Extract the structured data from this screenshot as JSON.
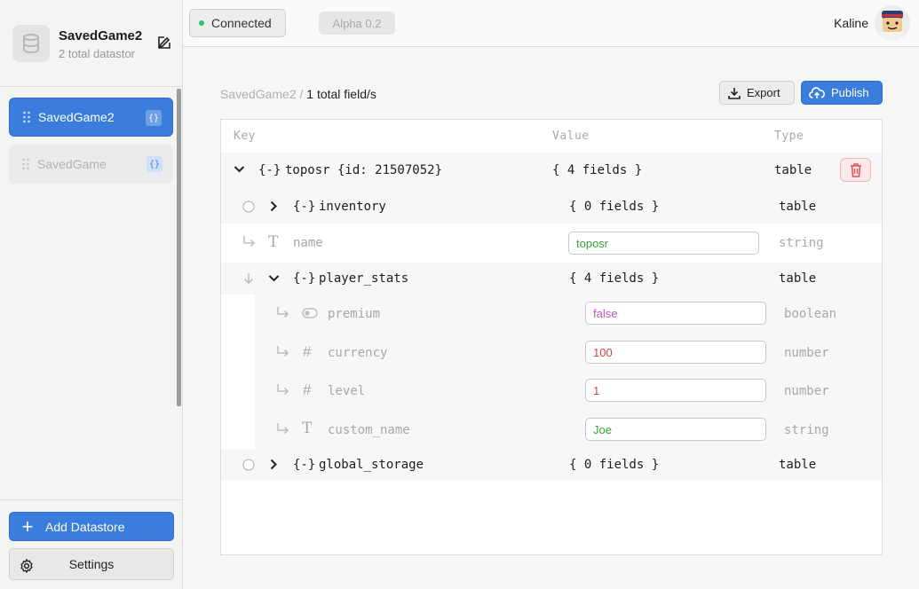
{
  "sidebar": {
    "title": "SavedGame2",
    "subtitle": "2 total datastor",
    "datastores": [
      {
        "name": "SavedGame2",
        "badge": "{}"
      },
      {
        "name": "SavedGame",
        "badge": "{}"
      }
    ],
    "add_label": "Add Datastore",
    "settings_label": "Settings"
  },
  "topbar": {
    "status": "Connected",
    "version": "Alpha 0.2",
    "user": "Kaline"
  },
  "main": {
    "breadcrumb_root": "SavedGame2",
    "breadcrumb_sep": "/",
    "breadcrumb_current": "1 total field/s",
    "export_label": "Export",
    "publish_label": "Publish",
    "headers": {
      "key": "Key",
      "value": "Value",
      "type": "Type"
    },
    "rows": {
      "root": {
        "key": "toposr {id: 21507052}",
        "value": "{ 4 fields }",
        "type": "table"
      },
      "inventory": {
        "key": "inventory",
        "value": "{ 0 fields }",
        "type": "table"
      },
      "name": {
        "key": "name",
        "value": "toposr",
        "type": "string"
      },
      "player_stats": {
        "key": "player_stats",
        "value": "{ 4 fields }",
        "type": "table"
      },
      "premium": {
        "key": "premium",
        "value": "false",
        "type": "boolean"
      },
      "currency": {
        "key": "currency",
        "value": "100",
        "type": "number"
      },
      "level": {
        "key": "level",
        "value": "1",
        "type": "number"
      },
      "custom_name": {
        "key": "custom_name",
        "value": "Joe",
        "type": "string"
      },
      "global_storage": {
        "key": "global_storage",
        "value": "{ 0 fields }",
        "type": "table"
      }
    }
  },
  "colors": {
    "accent": "#3b7ddd",
    "connected": "#2fc26a",
    "string_value": "#3aa13a",
    "number_value": "#d14747",
    "boolean_value": "#c94fc9",
    "delete": "#e05555"
  },
  "icons": [
    "database-icon",
    "edit-icon",
    "drag-handle-icon",
    "plus-icon",
    "gear-icon",
    "download-icon",
    "cloud-upload-icon",
    "chevron-down-icon",
    "chevron-right-icon",
    "braces-icon",
    "text-type-icon",
    "hash-icon",
    "toggle-icon",
    "return-arrow-icon",
    "arrow-down-icon",
    "radio-icon",
    "trash-icon"
  ]
}
